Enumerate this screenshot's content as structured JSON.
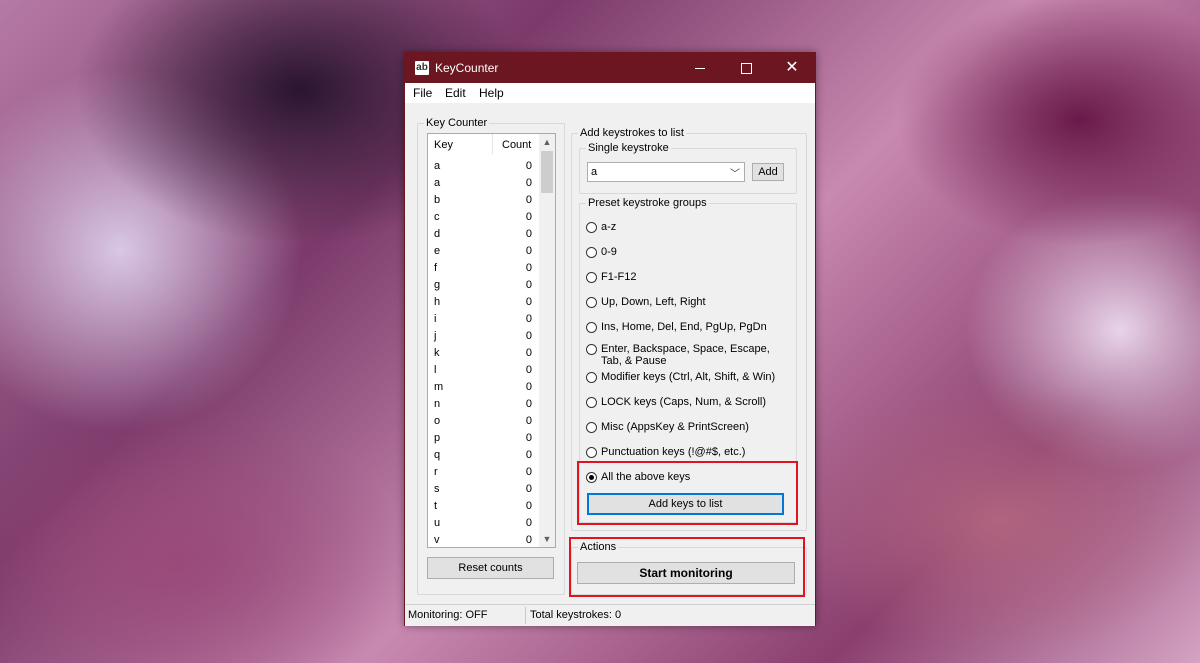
{
  "window": {
    "icon_text": "ab",
    "title": "KeyCounter",
    "controls": {
      "minimize": "minimize",
      "maximize": "maximize",
      "close": "✕"
    }
  },
  "menu": [
    "File",
    "Edit",
    "Help"
  ],
  "key_counter": {
    "group_title": "Key Counter",
    "columns": [
      "Key",
      "Count"
    ],
    "rows": [
      {
        "key": "a",
        "count": "0"
      },
      {
        "key": "a",
        "count": "0"
      },
      {
        "key": "b",
        "count": "0"
      },
      {
        "key": "c",
        "count": "0"
      },
      {
        "key": "d",
        "count": "0"
      },
      {
        "key": "e",
        "count": "0"
      },
      {
        "key": "f",
        "count": "0"
      },
      {
        "key": "g",
        "count": "0"
      },
      {
        "key": "h",
        "count": "0"
      },
      {
        "key": "i",
        "count": "0"
      },
      {
        "key": "j",
        "count": "0"
      },
      {
        "key": "k",
        "count": "0"
      },
      {
        "key": "l",
        "count": "0"
      },
      {
        "key": "m",
        "count": "0"
      },
      {
        "key": "n",
        "count": "0"
      },
      {
        "key": "o",
        "count": "0"
      },
      {
        "key": "p",
        "count": "0"
      },
      {
        "key": "q",
        "count": "0"
      },
      {
        "key": "r",
        "count": "0"
      },
      {
        "key": "s",
        "count": "0"
      },
      {
        "key": "t",
        "count": "0"
      },
      {
        "key": "u",
        "count": "0"
      },
      {
        "key": "v",
        "count": "0"
      }
    ],
    "reset_button": "Reset counts"
  },
  "add_keystrokes": {
    "group_title": "Add keystrokes to list",
    "single": {
      "title": "Single keystroke",
      "selected": "a",
      "add_button": "Add"
    },
    "preset": {
      "title": "Preset keystroke groups",
      "options": [
        {
          "label": "a-z",
          "checked": false
        },
        {
          "label": "0-9",
          "checked": false
        },
        {
          "label": "F1-F12",
          "checked": false
        },
        {
          "label": "Up, Down, Left, Right",
          "checked": false
        },
        {
          "label": "Ins, Home, Del, End, PgUp, PgDn",
          "checked": false
        },
        {
          "label": "Enter, Backspace, Space, Escape,",
          "label2": "Tab, & Pause",
          "checked": false
        },
        {
          "label": "Modifier keys (Ctrl, Alt, Shift, & Win)",
          "checked": false
        },
        {
          "label": "LOCK keys (Caps, Num, & Scroll)",
          "checked": false
        },
        {
          "label": "Misc (AppsKey & PrintScreen)",
          "checked": false
        },
        {
          "label": "Punctuation keys (!@#$, etc.)",
          "checked": false
        },
        {
          "label": "All the above keys",
          "checked": true
        }
      ],
      "add_keys_button": "Add keys to list"
    }
  },
  "actions": {
    "group_title": "Actions",
    "start_button": "Start monitoring"
  },
  "status": {
    "monitoring": "Monitoring: OFF",
    "total": "Total keystrokes: 0"
  },
  "colors": {
    "titlebar": "#6b1620",
    "highlight": "#e0141e",
    "focus": "#0078d7"
  }
}
